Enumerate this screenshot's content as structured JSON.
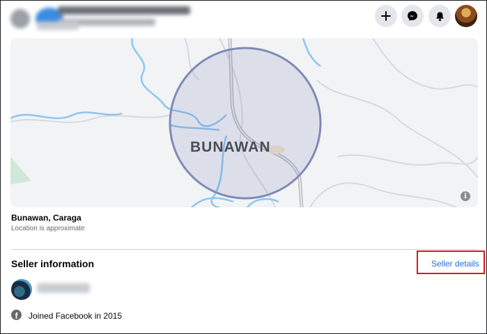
{
  "header": {
    "buttons": [
      {
        "name": "create",
        "icon": "plus-icon"
      },
      {
        "name": "messenger",
        "icon": "messenger-icon"
      },
      {
        "name": "notifications",
        "icon": "bell-icon"
      }
    ]
  },
  "map": {
    "place_label": "BUNAWAN",
    "info_glyph": "i"
  },
  "location": {
    "title": "Bunawan, Caraga",
    "subtitle": "Location is approximate"
  },
  "seller": {
    "section_title": "Seller information",
    "details_link": "Seller details",
    "joined_text": "Joined Facebook in 2015",
    "fb_glyph": "f"
  },
  "colors": {
    "link": "#216fdb",
    "highlight": "#e0141e",
    "map_circle": "#7d8ab5",
    "river": "#8ec5f2"
  }
}
